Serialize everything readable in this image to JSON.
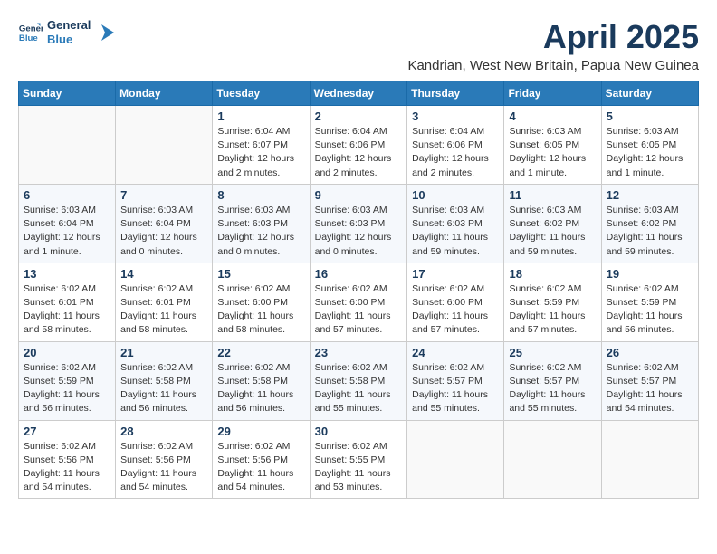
{
  "logo": {
    "text_general": "General",
    "text_blue": "Blue"
  },
  "title": "April 2025",
  "subtitle": "Kandrian, West New Britain, Papua New Guinea",
  "weekdays": [
    "Sunday",
    "Monday",
    "Tuesday",
    "Wednesday",
    "Thursday",
    "Friday",
    "Saturday"
  ],
  "weeks": [
    [
      {
        "day": "",
        "sunrise": "",
        "sunset": "",
        "daylight": ""
      },
      {
        "day": "",
        "sunrise": "",
        "sunset": "",
        "daylight": ""
      },
      {
        "day": "1",
        "sunrise": "Sunrise: 6:04 AM",
        "sunset": "Sunset: 6:07 PM",
        "daylight": "Daylight: 12 hours and 2 minutes."
      },
      {
        "day": "2",
        "sunrise": "Sunrise: 6:04 AM",
        "sunset": "Sunset: 6:06 PM",
        "daylight": "Daylight: 12 hours and 2 minutes."
      },
      {
        "day": "3",
        "sunrise": "Sunrise: 6:04 AM",
        "sunset": "Sunset: 6:06 PM",
        "daylight": "Daylight: 12 hours and 2 minutes."
      },
      {
        "day": "4",
        "sunrise": "Sunrise: 6:03 AM",
        "sunset": "Sunset: 6:05 PM",
        "daylight": "Daylight: 12 hours and 1 minute."
      },
      {
        "day": "5",
        "sunrise": "Sunrise: 6:03 AM",
        "sunset": "Sunset: 6:05 PM",
        "daylight": "Daylight: 12 hours and 1 minute."
      }
    ],
    [
      {
        "day": "6",
        "sunrise": "Sunrise: 6:03 AM",
        "sunset": "Sunset: 6:04 PM",
        "daylight": "Daylight: 12 hours and 1 minute."
      },
      {
        "day": "7",
        "sunrise": "Sunrise: 6:03 AM",
        "sunset": "Sunset: 6:04 PM",
        "daylight": "Daylight: 12 hours and 0 minutes."
      },
      {
        "day": "8",
        "sunrise": "Sunrise: 6:03 AM",
        "sunset": "Sunset: 6:03 PM",
        "daylight": "Daylight: 12 hours and 0 minutes."
      },
      {
        "day": "9",
        "sunrise": "Sunrise: 6:03 AM",
        "sunset": "Sunset: 6:03 PM",
        "daylight": "Daylight: 12 hours and 0 minutes."
      },
      {
        "day": "10",
        "sunrise": "Sunrise: 6:03 AM",
        "sunset": "Sunset: 6:03 PM",
        "daylight": "Daylight: 11 hours and 59 minutes."
      },
      {
        "day": "11",
        "sunrise": "Sunrise: 6:03 AM",
        "sunset": "Sunset: 6:02 PM",
        "daylight": "Daylight: 11 hours and 59 minutes."
      },
      {
        "day": "12",
        "sunrise": "Sunrise: 6:03 AM",
        "sunset": "Sunset: 6:02 PM",
        "daylight": "Daylight: 11 hours and 59 minutes."
      }
    ],
    [
      {
        "day": "13",
        "sunrise": "Sunrise: 6:02 AM",
        "sunset": "Sunset: 6:01 PM",
        "daylight": "Daylight: 11 hours and 58 minutes."
      },
      {
        "day": "14",
        "sunrise": "Sunrise: 6:02 AM",
        "sunset": "Sunset: 6:01 PM",
        "daylight": "Daylight: 11 hours and 58 minutes."
      },
      {
        "day": "15",
        "sunrise": "Sunrise: 6:02 AM",
        "sunset": "Sunset: 6:00 PM",
        "daylight": "Daylight: 11 hours and 58 minutes."
      },
      {
        "day": "16",
        "sunrise": "Sunrise: 6:02 AM",
        "sunset": "Sunset: 6:00 PM",
        "daylight": "Daylight: 11 hours and 57 minutes."
      },
      {
        "day": "17",
        "sunrise": "Sunrise: 6:02 AM",
        "sunset": "Sunset: 6:00 PM",
        "daylight": "Daylight: 11 hours and 57 minutes."
      },
      {
        "day": "18",
        "sunrise": "Sunrise: 6:02 AM",
        "sunset": "Sunset: 5:59 PM",
        "daylight": "Daylight: 11 hours and 57 minutes."
      },
      {
        "day": "19",
        "sunrise": "Sunrise: 6:02 AM",
        "sunset": "Sunset: 5:59 PM",
        "daylight": "Daylight: 11 hours and 56 minutes."
      }
    ],
    [
      {
        "day": "20",
        "sunrise": "Sunrise: 6:02 AM",
        "sunset": "Sunset: 5:59 PM",
        "daylight": "Daylight: 11 hours and 56 minutes."
      },
      {
        "day": "21",
        "sunrise": "Sunrise: 6:02 AM",
        "sunset": "Sunset: 5:58 PM",
        "daylight": "Daylight: 11 hours and 56 minutes."
      },
      {
        "day": "22",
        "sunrise": "Sunrise: 6:02 AM",
        "sunset": "Sunset: 5:58 PM",
        "daylight": "Daylight: 11 hours and 56 minutes."
      },
      {
        "day": "23",
        "sunrise": "Sunrise: 6:02 AM",
        "sunset": "Sunset: 5:58 PM",
        "daylight": "Daylight: 11 hours and 55 minutes."
      },
      {
        "day": "24",
        "sunrise": "Sunrise: 6:02 AM",
        "sunset": "Sunset: 5:57 PM",
        "daylight": "Daylight: 11 hours and 55 minutes."
      },
      {
        "day": "25",
        "sunrise": "Sunrise: 6:02 AM",
        "sunset": "Sunset: 5:57 PM",
        "daylight": "Daylight: 11 hours and 55 minutes."
      },
      {
        "day": "26",
        "sunrise": "Sunrise: 6:02 AM",
        "sunset": "Sunset: 5:57 PM",
        "daylight": "Daylight: 11 hours and 54 minutes."
      }
    ],
    [
      {
        "day": "27",
        "sunrise": "Sunrise: 6:02 AM",
        "sunset": "Sunset: 5:56 PM",
        "daylight": "Daylight: 11 hours and 54 minutes."
      },
      {
        "day": "28",
        "sunrise": "Sunrise: 6:02 AM",
        "sunset": "Sunset: 5:56 PM",
        "daylight": "Daylight: 11 hours and 54 minutes."
      },
      {
        "day": "29",
        "sunrise": "Sunrise: 6:02 AM",
        "sunset": "Sunset: 5:56 PM",
        "daylight": "Daylight: 11 hours and 54 minutes."
      },
      {
        "day": "30",
        "sunrise": "Sunrise: 6:02 AM",
        "sunset": "Sunset: 5:55 PM",
        "daylight": "Daylight: 11 hours and 53 minutes."
      },
      {
        "day": "",
        "sunrise": "",
        "sunset": "",
        "daylight": ""
      },
      {
        "day": "",
        "sunrise": "",
        "sunset": "",
        "daylight": ""
      },
      {
        "day": "",
        "sunrise": "",
        "sunset": "",
        "daylight": ""
      }
    ]
  ]
}
